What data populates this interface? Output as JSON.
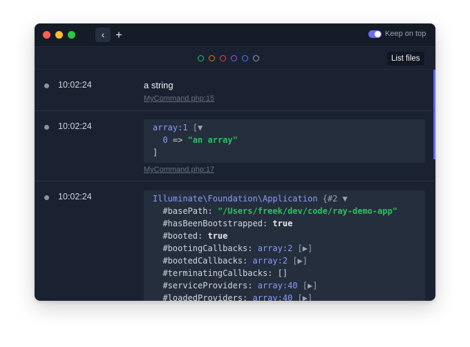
{
  "titlebar": {
    "back_icon": "‹",
    "add_icon": "+",
    "keep_on_top_label": "Keep on top",
    "keep_on_top_enabled": true
  },
  "filters": {
    "colors": [
      "#22c55e",
      "#f97316",
      "#ef4444",
      "#8b5cf6",
      "#3b82f6",
      "#9ca3af"
    ],
    "list_files_label": "List files"
  },
  "entries": [
    {
      "time": "10:02:24",
      "text": "a string",
      "file": "MyCommand.php:15"
    },
    {
      "time": "10:02:24",
      "array": {
        "type": "array:1",
        "open": " [▼",
        "key": "0",
        "arrow": " => ",
        "value": "\"an array\"",
        "close": "]"
      },
      "file": "MyCommand.php:17"
    },
    {
      "time": "10:02:24",
      "object": {
        "class": "Illuminate\\Foundation\\Application",
        "id": " {#2 ▼",
        "props": [
          {
            "name": "#basePath",
            "sep": ": ",
            "value": "\"/Users/freek/dev/code/ray-demo-app\"",
            "kind": "str",
            "suffix": ""
          },
          {
            "name": "#hasBeenBootstrapped",
            "sep": ": ",
            "value": "true",
            "kind": "bool",
            "suffix": ""
          },
          {
            "name": "#booted",
            "sep": ": ",
            "value": "true",
            "kind": "bool",
            "suffix": ""
          },
          {
            "name": "#bootingCallbacks",
            "sep": ": ",
            "value": "array:2",
            "kind": "type",
            "suffix": " [▶]"
          },
          {
            "name": "#bootedCallbacks",
            "sep": ": ",
            "value": "array:2",
            "kind": "type",
            "suffix": " [▶]"
          },
          {
            "name": "#terminatingCallbacks",
            "sep": ": ",
            "value": "[]",
            "kind": "plain",
            "suffix": ""
          },
          {
            "name": "#serviceProviders",
            "sep": ": ",
            "value": "array:40",
            "kind": "type",
            "suffix": " [▶]"
          },
          {
            "name": "#loadedProviders",
            "sep": ": ",
            "value": "array:40",
            "kind": "type",
            "suffix": " [▶]"
          }
        ]
      }
    }
  ]
}
